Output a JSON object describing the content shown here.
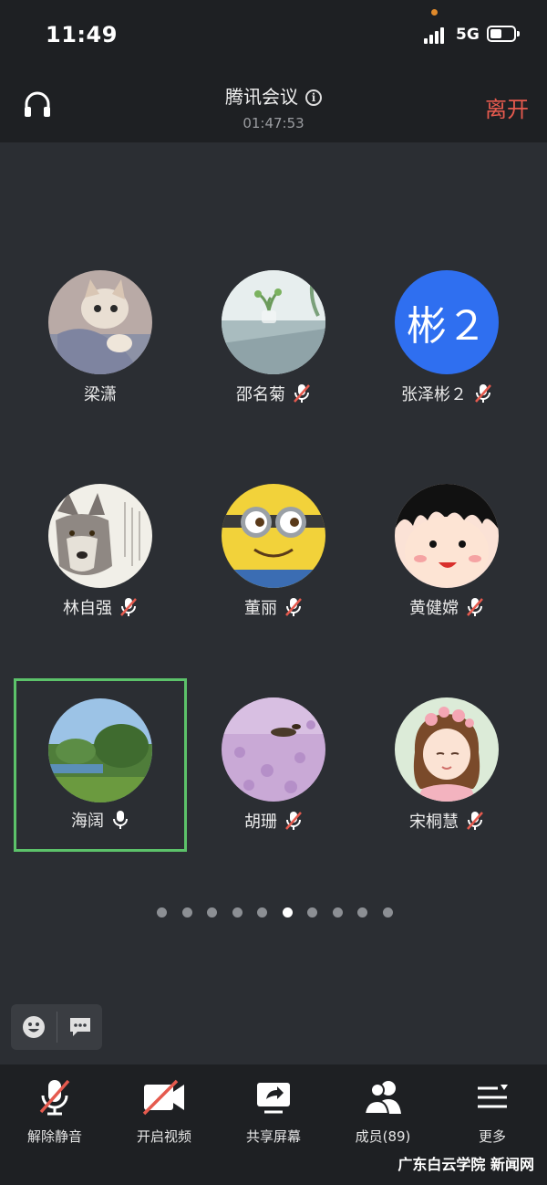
{
  "status_bar": {
    "time": "11:49",
    "network": "5G"
  },
  "header": {
    "title": "腾讯会议",
    "duration": "01:47:53",
    "leave_label": "离开"
  },
  "participants": [
    {
      "name": "梁潇",
      "muted": false,
      "show_mic": false,
      "avatar": "cat-photo"
    },
    {
      "name": "邵名菊",
      "muted": true,
      "show_mic": true,
      "avatar": "room-photo"
    },
    {
      "name": "张泽彬２",
      "muted": true,
      "show_mic": true,
      "avatar_text": "彬２",
      "avatar_color": "#2f6ff0"
    },
    {
      "name": "林自强",
      "muted": true,
      "show_mic": true,
      "avatar": "wolf-photo"
    },
    {
      "name": "董丽",
      "muted": true,
      "show_mic": true,
      "avatar": "minion-photo"
    },
    {
      "name": "黄健嫦",
      "muted": true,
      "show_mic": true,
      "avatar": "cartoon-girl"
    },
    {
      "name": "海阔",
      "muted": false,
      "show_mic": true,
      "avatar": "landscape-photo",
      "speaking": true
    },
    {
      "name": "胡珊",
      "muted": true,
      "show_mic": true,
      "avatar": "lavender-photo"
    },
    {
      "name": "宋桐慧",
      "muted": true,
      "show_mic": true,
      "avatar": "flower-girl"
    }
  ],
  "pagination": {
    "total": 10,
    "current": 6
  },
  "toolbar": {
    "unmute_label": "解除静音",
    "video_label": "开启视频",
    "share_label": "共享屏幕",
    "members_label": "成员(89)",
    "more_label": "更多"
  },
  "watermark": "广东白云学院  新闻网",
  "colors": {
    "accent_red": "#e55a4e",
    "active_border": "#5cc26a",
    "text_avatar_bg": "#2f6ff0"
  }
}
